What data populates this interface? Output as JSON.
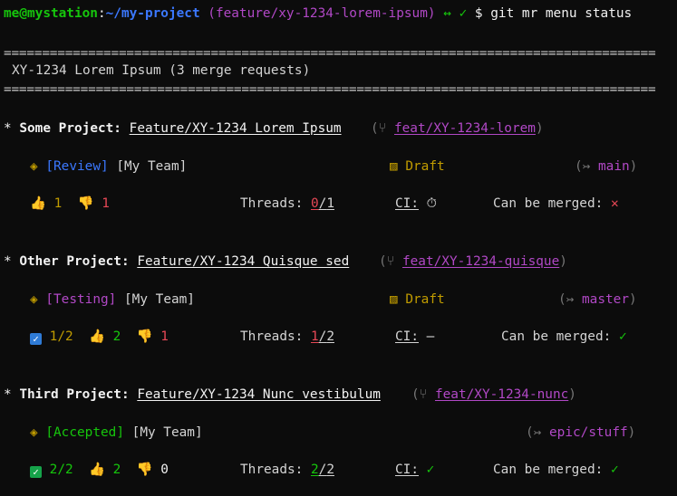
{
  "prompt": {
    "user_host": "me@mystation",
    "colon": ":",
    "path": "~/my-project",
    "branch": "(feature/xy-1234-lorem-ipsum)",
    "arrows": "↔",
    "check": "✓",
    "dollar": "$",
    "command": "git mr menu status"
  },
  "header": {
    "separator": "==========================================================================================",
    "title": "XY-1234 Lorem Ipsum (3 merge requests)"
  },
  "labels": {
    "threads": "Threads:",
    "ci": "CI:",
    "can_be_merged": "Can be merged:",
    "star": "*"
  },
  "mrs": [
    {
      "project": "Some Project:",
      "title": "Feature/XY-1234 Lorem Ipsum",
      "source_branch": "feat/XY-1234-lorem",
      "status": "[Review]",
      "team": "[My Team]",
      "draft": "Draft",
      "target_branch": "main",
      "approvals": "",
      "thumbs_up": "1",
      "thumbs_down": "1",
      "threads_open": "0",
      "threads_total": "1",
      "ci_icon": "stopwatch-icon",
      "mergeable_icon": "cross-icon"
    },
    {
      "project": "Other Project:",
      "title": "Feature/XY-1234 Quisque sed",
      "source_branch": "feat/XY-1234-quisque",
      "status": "[Testing]",
      "team": "[My Team]",
      "draft": "Draft",
      "target_branch": "master",
      "approvals": "1/2",
      "thumbs_up": "2",
      "thumbs_down": "1",
      "threads_open": "1",
      "threads_total": "2",
      "ci_icon": "dash-icon",
      "mergeable_icon": "check-icon"
    },
    {
      "project": "Third Project:",
      "title": "Feature/XY-1234 Nunc vestibulum",
      "source_branch": "feat/XY-1234-nunc",
      "status": "[Accepted]",
      "team": "[My Team]",
      "draft": "",
      "target_branch": "epic/stuff",
      "approvals": "2/2",
      "thumbs_up": "2",
      "thumbs_down": "0",
      "threads_open": "2",
      "threads_total": "2",
      "ci_icon": "check-icon",
      "mergeable_icon": "check-icon"
    }
  ],
  "colors": {
    "background": "#0c0c0c",
    "green": "#16c60c",
    "blue": "#3b78ff",
    "purple": "#b148c6",
    "yellow": "#c19c00",
    "red": "#e74856"
  }
}
